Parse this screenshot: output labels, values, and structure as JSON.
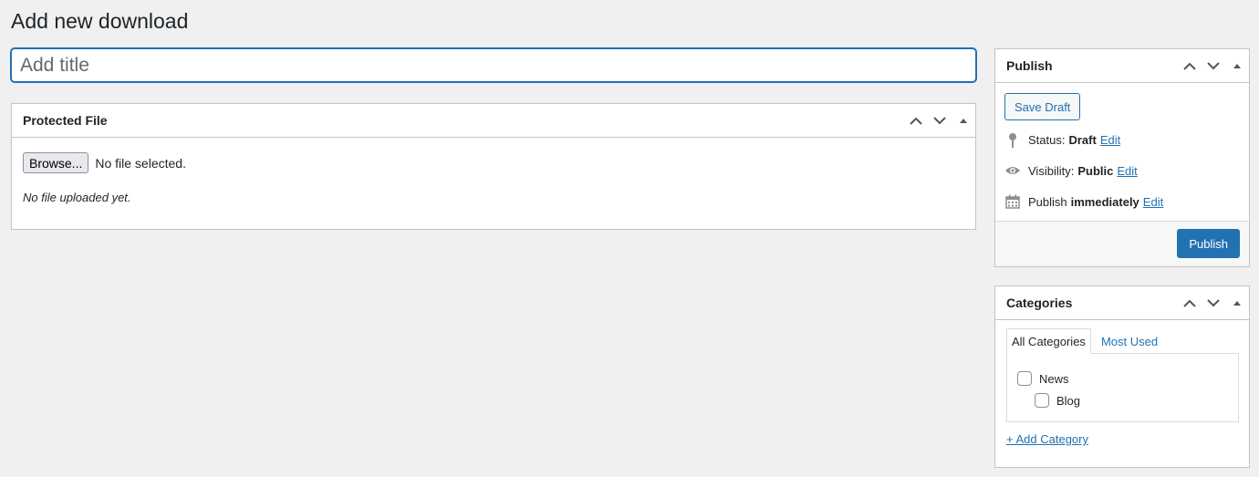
{
  "page": {
    "title": "Add new download"
  },
  "title_field": {
    "placeholder": "Add title",
    "value": ""
  },
  "protected_file": {
    "heading": "Protected File",
    "browse_label": "Browse...",
    "file_status": "No file selected.",
    "note": "No file uploaded yet."
  },
  "publish": {
    "heading": "Publish",
    "save_draft_label": "Save Draft",
    "status_label": "Status:",
    "status_value": "Draft",
    "visibility_label": "Visibility:",
    "visibility_value": "Public",
    "schedule_label": "Publish",
    "schedule_value": "immediately",
    "edit_label": "Edit",
    "publish_button": "Publish"
  },
  "categories": {
    "heading": "Categories",
    "tabs": [
      "All Categories",
      "Most Used"
    ],
    "items": [
      {
        "label": "News",
        "checked": false
      },
      {
        "label": "Blog",
        "checked": false
      }
    ],
    "add_link": "+ Add Category"
  },
  "icons": {
    "postbox_handles": [
      "chevron-up-icon",
      "chevron-down-icon",
      "triangle-toggle-icon"
    ],
    "status": "pin-icon",
    "visibility": "eye-icon",
    "schedule": "calendar-icon"
  },
  "colors": {
    "accent": "#2271b1",
    "background": "#f0f0f1",
    "border": "#c3c4c7"
  }
}
